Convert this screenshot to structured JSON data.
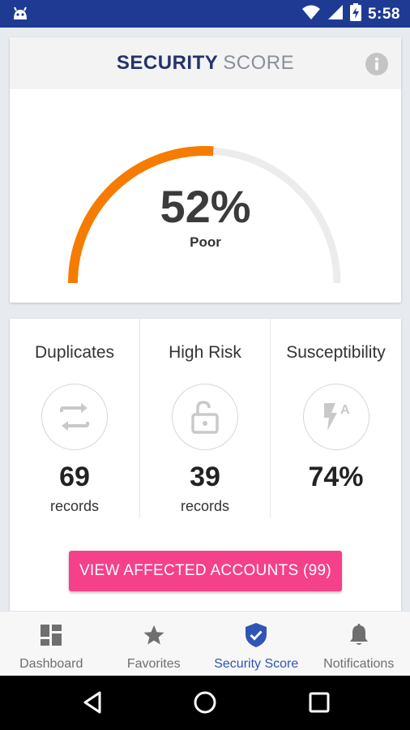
{
  "status_bar": {
    "time": "5:58",
    "icons": [
      "android-debug-icon",
      "wifi-icon",
      "signal-icon",
      "battery-charging-icon"
    ]
  },
  "score": {
    "title_strong": "SECURITY",
    "title_light": "SCORE",
    "percent": "52%",
    "percent_value": 0.52,
    "rating": "Poor",
    "colors": {
      "progress": "#f57c00",
      "track": "#ececec"
    }
  },
  "stats": [
    {
      "label": "Duplicates",
      "value": "69",
      "unit": "records",
      "icon": "swap-arrows-icon"
    },
    {
      "label": "High Risk",
      "value": "39",
      "unit": "records",
      "icon": "unlocked-padlock-icon"
    },
    {
      "label": "Susceptibility",
      "value": "74%",
      "unit": "",
      "icon": "flash-auto-icon"
    }
  ],
  "cta": {
    "label": "VIEW AFFECTED ACCOUNTS (99)",
    "color": "#f5408a"
  },
  "bottom_nav": [
    {
      "label": "Dashboard",
      "icon": "dashboard-icon",
      "active": false
    },
    {
      "label": "Favorites",
      "icon": "star-icon",
      "active": false
    },
    {
      "label": "Security Score",
      "icon": "shield-check-icon",
      "active": true
    },
    {
      "label": "Notifications",
      "icon": "bell-icon",
      "active": false
    }
  ],
  "system_nav": [
    "back-icon",
    "home-icon",
    "recents-icon"
  ]
}
